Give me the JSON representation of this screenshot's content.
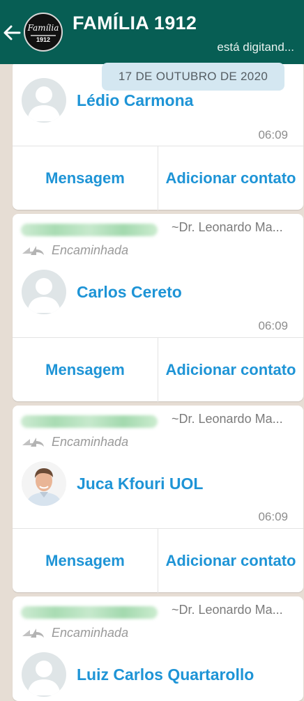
{
  "header": {
    "group_name": "FAMÍLIA 1912",
    "status": "está digitand...",
    "logo_text": "Família",
    "logo_year": "1912"
  },
  "date_chip": "17 DE OUTUBRO DE 2020",
  "messages": [
    {
      "contact_name": "Lédio Carmona",
      "time": "06:09",
      "btn_message": "Mensagem",
      "btn_add": "Adicionar contato"
    },
    {
      "sender": "~Dr. Leonardo Ma...",
      "forwarded_label": "Encaminhada",
      "contact_name": "Carlos Cereto",
      "time": "06:09",
      "btn_message": "Mensagem",
      "btn_add": "Adicionar contato"
    },
    {
      "sender": "~Dr. Leonardo Ma...",
      "forwarded_label": "Encaminhada",
      "contact_name": "Juca Kfouri UOL",
      "time": "06:09",
      "btn_message": "Mensagem",
      "btn_add": "Adicionar contato"
    },
    {
      "sender": "~Dr. Leonardo Ma...",
      "forwarded_label": "Encaminhada",
      "contact_name": "Luiz Carlos Quartarollo"
    }
  ],
  "colors": {
    "header_bg": "#075e54",
    "chat_bg": "#e6ddd4",
    "link_blue": "#1e94d6",
    "date_chip_bg": "#d4e7f1"
  }
}
